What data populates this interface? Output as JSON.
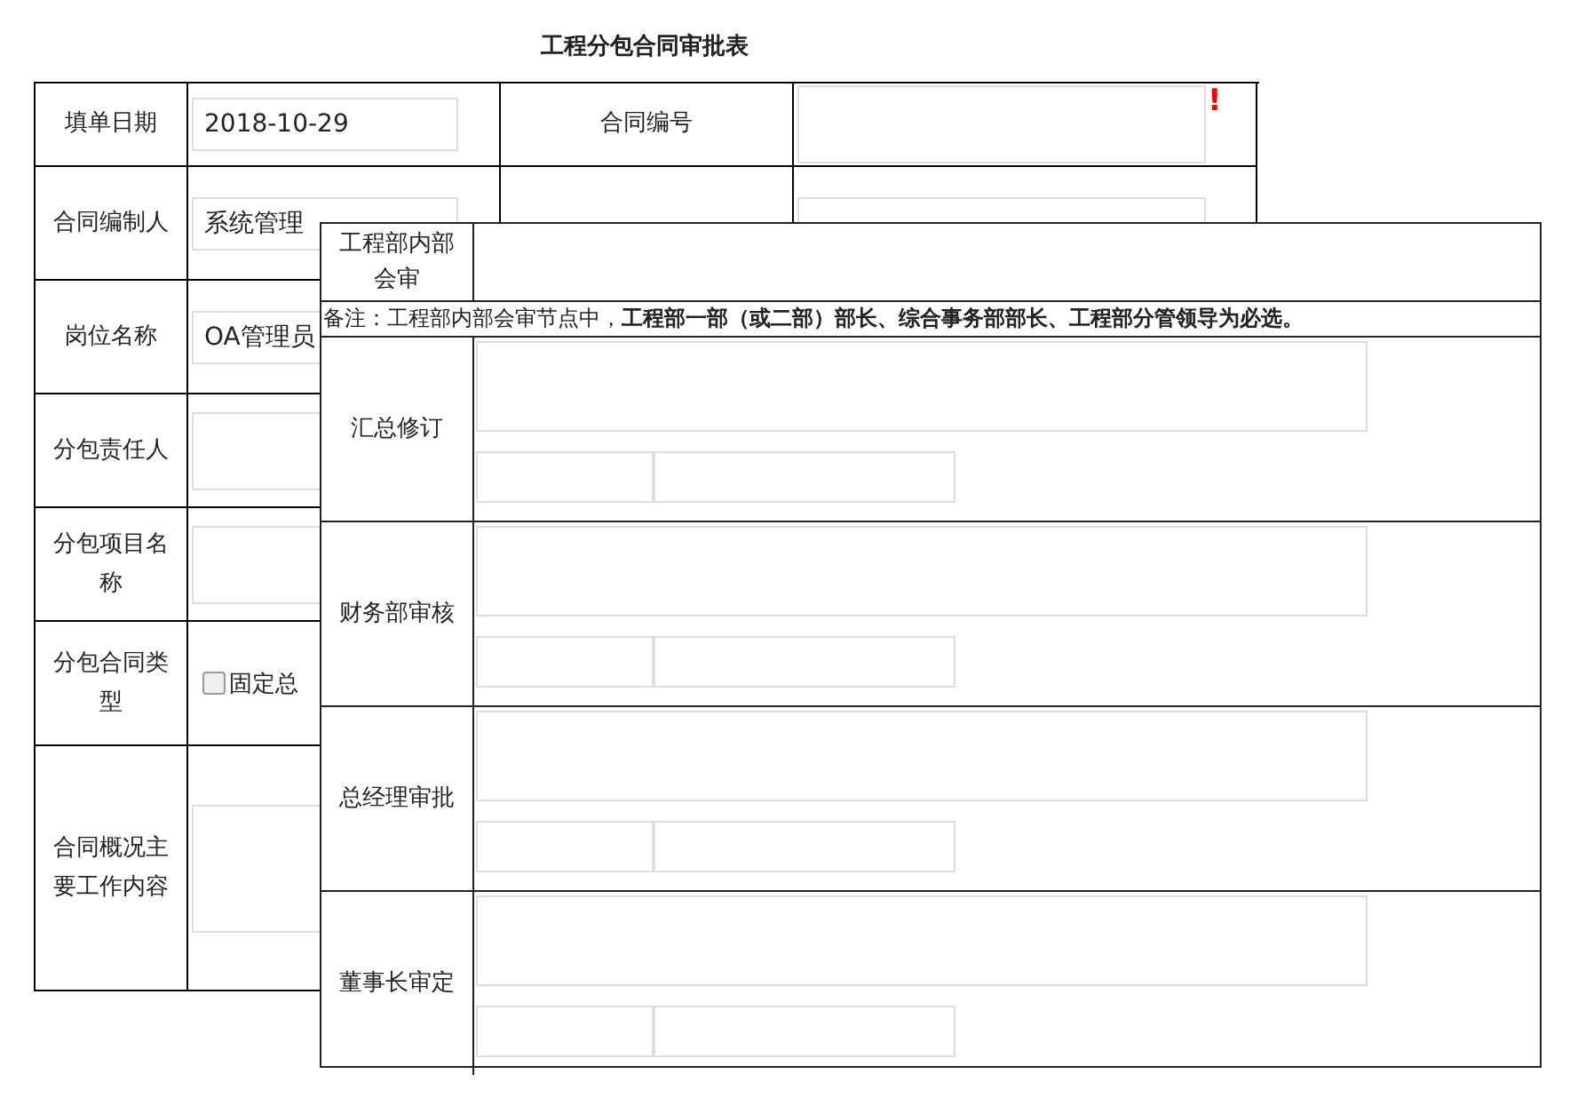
{
  "title": "工程分包合同审批表",
  "form": {
    "rows": [
      {
        "kind": "pair",
        "label": "填单日期",
        "value": "2018-10-29",
        "label_2": "合同编号",
        "required_mark": "!"
      },
      {
        "kind": "pair",
        "label": "合同编制人",
        "value": "系统管理"
      },
      {
        "kind": "field",
        "label": "岗位名称",
        "value": "OA管理员"
      },
      {
        "kind": "field",
        "label": "分包责任人"
      },
      {
        "kind": "field",
        "label": "分包项目名称"
      },
      {
        "kind": "checkbox",
        "label": "分包合同类型",
        "option": "固定总",
        "checked": false
      },
      {
        "kind": "textarea",
        "label": "合同概况主要工作内容"
      }
    ]
  },
  "review_panel": {
    "header_label": "工程部内部会审",
    "note": "备注：工程部内部会审节点中，**工程部一部（或二部）部长、综合事务部部长、工程部分管领导为必选。**",
    "sections": [
      {
        "label": "汇总修订"
      },
      {
        "label": "财务部审核"
      },
      {
        "label": "总经理审批"
      },
      {
        "label": "董事长审定"
      }
    ]
  }
}
